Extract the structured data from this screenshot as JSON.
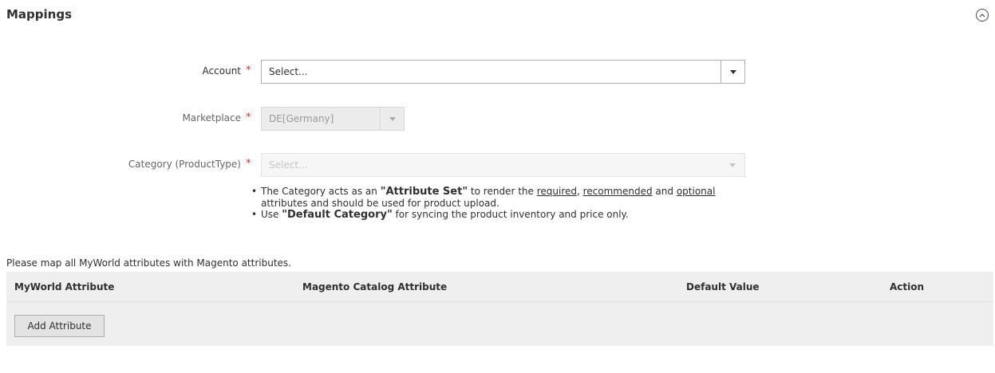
{
  "section": {
    "title": "Mappings"
  },
  "fields": {
    "account": {
      "label": "Account",
      "required_mark": "*",
      "value": "Select..."
    },
    "marketplace": {
      "label": "Marketplace",
      "required_mark": "*",
      "value": "DE[Germany]"
    },
    "category": {
      "label": "Category (ProductType)",
      "required_mark": "*",
      "value": "Select..."
    }
  },
  "notes": {
    "line1": {
      "pre": "The Category acts as an ",
      "bold": "\"Attribute Set\"",
      "mid": " to render the ",
      "link1": "required",
      "sep1": ", ",
      "link2": "recommended",
      "sep2": " and ",
      "link3": "optional",
      "post": " attributes and should be used for product upload."
    },
    "line2": {
      "pre": "Use ",
      "bold": "\"Default Category\"",
      "post": " for syncing the product inventory and price only."
    }
  },
  "mapping": {
    "intro": "Please map all MyWorld attributes with Magento attributes.",
    "columns": [
      "MyWorld Attribute",
      "Magento Catalog Attribute",
      "Default Value",
      "Action"
    ],
    "add_button": "Add Attribute"
  },
  "icons": {
    "collapse": "chevron-up-circle-icon",
    "dropdown": "caret-down-icon"
  },
  "colors": {
    "required": "#e22626",
    "text": "#303030",
    "grid_bg": "#efefef"
  }
}
